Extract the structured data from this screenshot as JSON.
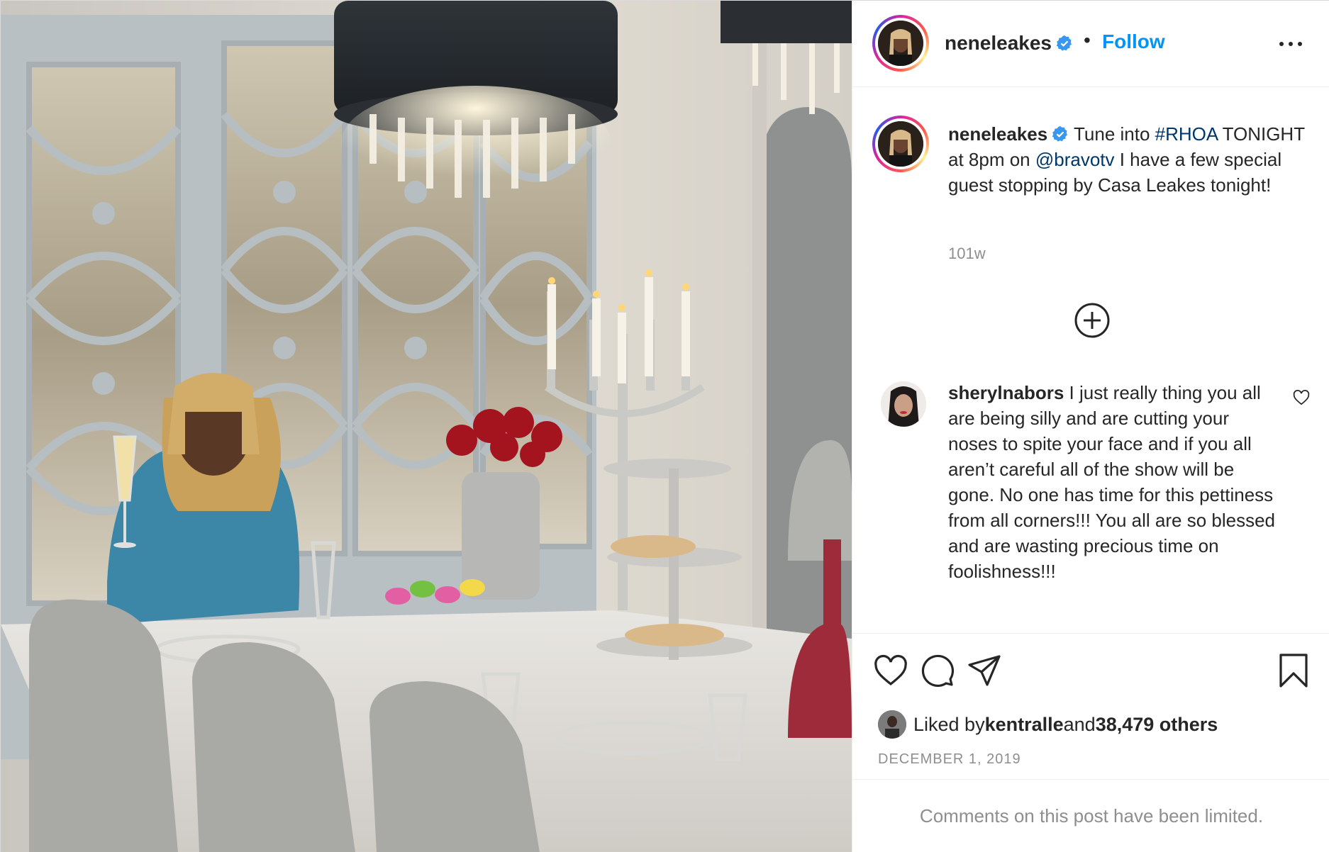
{
  "post": {
    "author": "neneleakes",
    "follow_label": "Follow",
    "separator": "•",
    "photo_alt": "NeNe Leakes seated at a dining table with a champagne glass, chandeliers, candelabra, roses and desserts"
  },
  "caption": {
    "username": "neneleakes",
    "text_1": "Tune into ",
    "hashtag": "#RHOA",
    "text_2": " TONIGHT at 8pm on ",
    "mention": "@bravotv",
    "text_3": " I have a few special guest stopping by Casa Leakes tonight!",
    "time": "101w"
  },
  "comment": {
    "username": "sherylnabors",
    "text": "I just really thing you all are being silly and are cutting your noses to spite your face and if you all aren’t careful all of the show will be gone. No one has time for this pettiness from all corners!!! You all are so blessed and are wasting precious time on foolishness!!!"
  },
  "likes": {
    "prefix": "Liked by ",
    "liker": "kentralle",
    "middle": " and ",
    "others": "38,479 others"
  },
  "date": "DECEMBER 1, 2019",
  "comments_limited": "Comments on this post have been limited.",
  "icons": {
    "verified": "verified-badge-icon",
    "more": "more-options-icon",
    "add": "add-circle-icon",
    "like": "heart-icon",
    "comment": "comment-bubble-icon",
    "share": "paper-plane-icon",
    "save": "bookmark-icon"
  },
  "colors": {
    "accent": "#0095f6",
    "verified": "#3897f0",
    "link": "#00376b",
    "muted": "#8e8e8e",
    "text": "#262626"
  }
}
